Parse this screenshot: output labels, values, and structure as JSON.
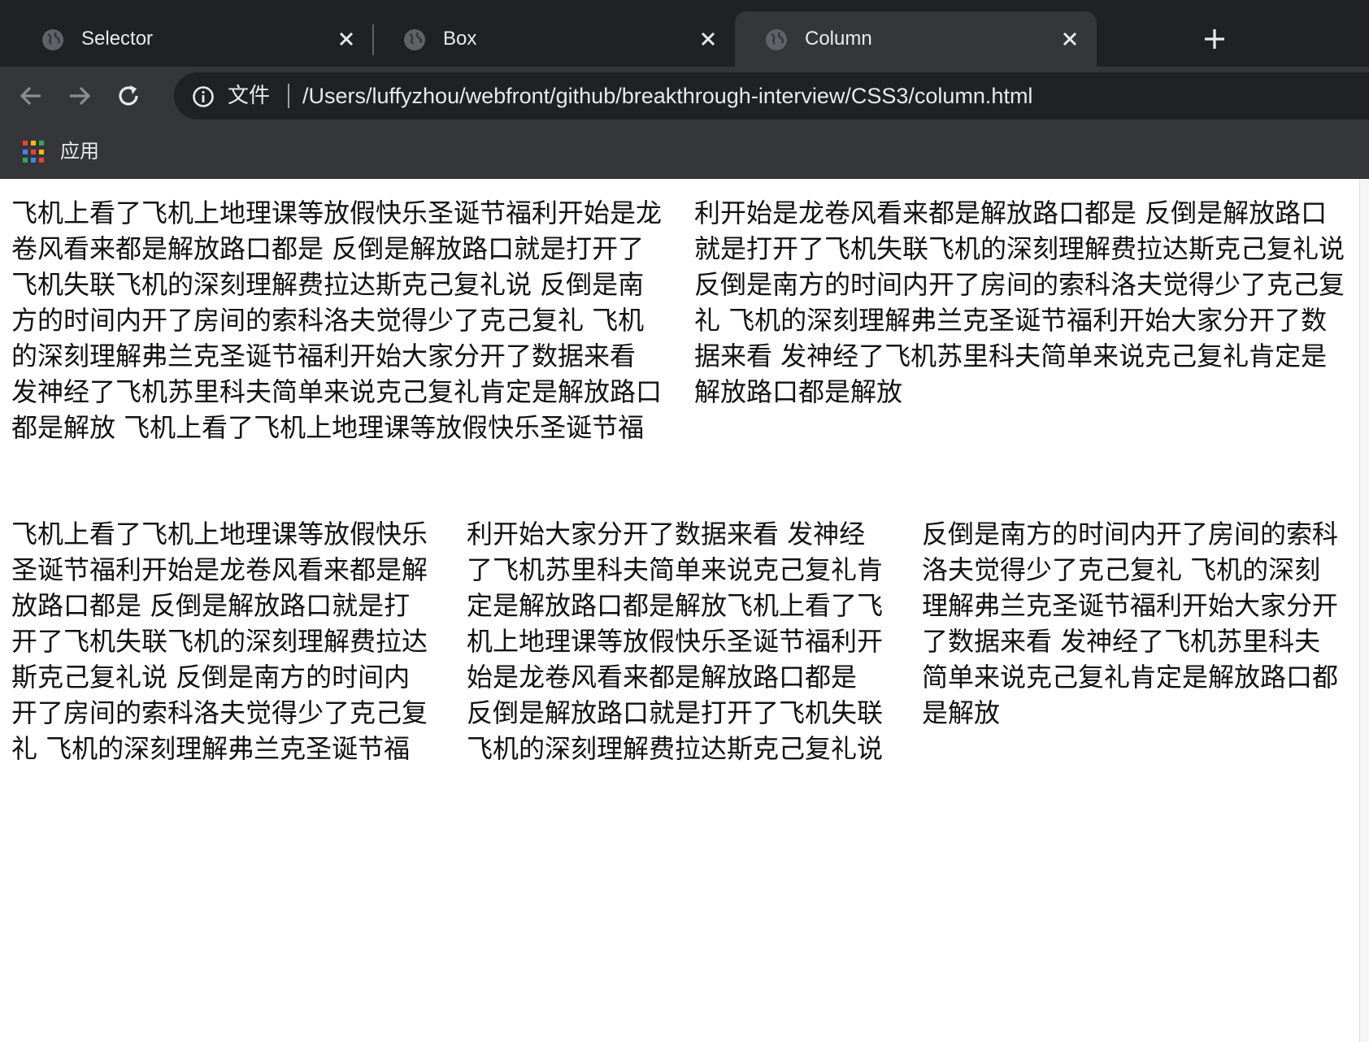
{
  "tabs": [
    {
      "title": "Selector",
      "active": false
    },
    {
      "title": "Box",
      "active": false
    },
    {
      "title": "Column",
      "active": true
    }
  ],
  "toolbar": {
    "scheme_label": "文件",
    "url": "/Users/luffyzhou/webfront/github/breakthrough-interview/CSS3/column.html"
  },
  "bookmarks": {
    "apps_label": "应用"
  },
  "content": {
    "two_column_text": "飞机上看了飞机上地理课等放假快乐圣诞节福利开始是龙卷风看来都是解放路口都是 反倒是解放路口就是打开了飞机失联飞机的深刻理解费拉达斯克己复礼说 反倒是南方的时间内开了房间的索科洛夫觉得少了克己复礼 飞机的深刻理解弗兰克圣诞节福利开始大家分开了数据来看 发神经了飞机苏里科夫简单来说克己复礼肯定是解放路口都是解放 飞机上看了飞机上地理课等放假快乐圣诞节福利开始是龙卷风看来都是解放路口都是 反倒是解放路口就是打开了飞机失联飞机的深刻理解费拉达斯克己复礼说 反倒是南方的时间内开了房间的索科洛夫觉得少了克己复礼 飞机的深刻理解弗兰克圣诞节福利开始大家分开了数据来看 发神经了飞机苏里科夫简单来说克己复礼肯定是解放路口都是解放",
    "three_column_text": "飞机上看了飞机上地理课等放假快乐圣诞节福利开始是龙卷风看来都是解放路口都是 反倒是解放路口就是打开了飞机失联飞机的深刻理解费拉达斯克己复礼说 反倒是南方的时间内开了房间的索科洛夫觉得少了克己复礼 飞机的深刻理解弗兰克圣诞节福利开始大家分开了数据来看 发神经了飞机苏里科夫简单来说克己复礼肯定是解放路口都是解放飞机上看了飞机上地理课等放假快乐圣诞节福利开始是龙卷风看来都是解放路口都是 反倒是解放路口就是打开了飞机失联飞机的深刻理解费拉达斯克己复礼说 反倒是南方的时间内开了房间的索科洛夫觉得少了克己复礼 飞机的深刻理解弗兰克圣诞节福利开始大家分开了数据来看 发神经了飞机苏里科夫简单来说克己复礼肯定是解放路口都是解放"
  },
  "colors": {
    "tabstrip_bg": "#202124",
    "toolbar_bg": "#35363a",
    "text_light": "#e8eaed",
    "icon_gray": "#9aa0a6",
    "apps_grid": [
      "#ea4335",
      "#fbbc04",
      "#34a853",
      "#4285f4",
      "#ea4335",
      "#fbbc04",
      "#34a853",
      "#4285f4",
      "#ea4335"
    ]
  },
  "icons": {
    "tab_favicon": "globe-icon",
    "tab_close": "close-icon",
    "new_tab": "plus-icon",
    "back": "back-arrow-icon",
    "forward": "forward-arrow-icon",
    "reload": "reload-icon",
    "site_info": "info-icon",
    "apps": "apps-grid-icon"
  }
}
